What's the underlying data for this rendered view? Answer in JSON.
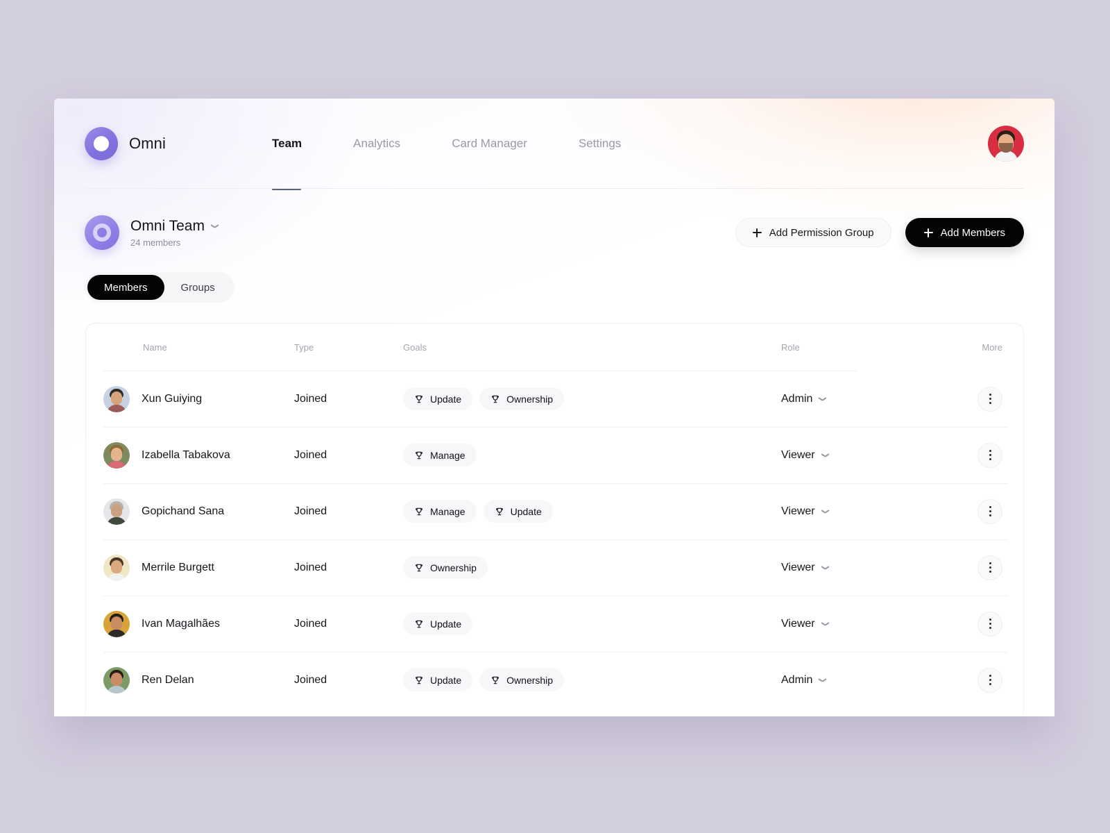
{
  "brand": {
    "name": "Omni",
    "logo_icon": "omni-ring-logo",
    "accent": "#8375de"
  },
  "nav": {
    "items": [
      {
        "label": "Team",
        "active": true
      },
      {
        "label": "Analytics",
        "active": false
      },
      {
        "label": "Card Manager",
        "active": false
      },
      {
        "label": "Settings",
        "active": false
      }
    ],
    "active_underline_color": "#5b6275"
  },
  "account": {
    "avatar_icon": "user-avatar",
    "avatar_bg": "#d92d42"
  },
  "team_header": {
    "avatar_icon": "team-avatar",
    "name": "Omni Team",
    "dropdown_icon": "chevron-down-icon",
    "members_count": "24 members",
    "actions": [
      {
        "label": "Add Permission Group",
        "icon": "plus-icon",
        "style": "ghost"
      },
      {
        "label": "Add Members",
        "icon": "plus-icon",
        "style": "primary"
      }
    ]
  },
  "segmented": {
    "options": [
      {
        "label": "Members",
        "active": true
      },
      {
        "label": "Groups",
        "active": false
      }
    ]
  },
  "table": {
    "columns": [
      "Name",
      "Type",
      "Goals",
      "Role",
      "More"
    ],
    "rows": [
      {
        "name": "Xun Guiying",
        "type": "Joined",
        "goals": [
          "Update",
          "Ownership"
        ],
        "role": "Admin",
        "avatar": {
          "bg": "#c4d2e4",
          "hair": "#2f2a24",
          "face": "#d8a47e",
          "body": "#9c5a58"
        }
      },
      {
        "name": "Izabella Tabakova",
        "type": "Joined",
        "goals": [
          "Manage"
        ],
        "role": "Viewer",
        "avatar": {
          "bg": "#7d8a5e",
          "hair": "#8c6a3a",
          "face": "#e3b48d",
          "body": "#d86a78"
        }
      },
      {
        "name": "Gopichand Sana",
        "type": "Joined",
        "goals": [
          "Manage",
          "Update"
        ],
        "role": "Viewer",
        "avatar": {
          "bg": "#e6e6ea",
          "hair": "#b9b2ab",
          "face": "#caa183",
          "body": "#3f4a3d"
        }
      },
      {
        "name": "Merrile Burgett",
        "type": "Joined",
        "goals": [
          "Ownership"
        ],
        "role": "Viewer",
        "avatar": {
          "bg": "#efe6c4",
          "hair": "#4a3527",
          "face": "#dba97f",
          "body": "#f2f2f2"
        }
      },
      {
        "name": "Ivan Magalhães",
        "type": "Joined",
        "goals": [
          "Update"
        ],
        "role": "Viewer",
        "avatar": {
          "bg": "#d8a43a",
          "hair": "#241c16",
          "face": "#c98d62",
          "body": "#2e2a28"
        }
      },
      {
        "name": "Ren Delan",
        "type": "Joined",
        "goals": [
          "Update",
          "Ownership"
        ],
        "role": "Admin",
        "avatar": {
          "bg": "#7e9a66",
          "hair": "#2a1c14",
          "face": "#c98c66",
          "body": "#b9c6cd"
        }
      }
    ],
    "goal_icon": "trophy-icon",
    "role_dropdown_icon": "chevron-down-icon",
    "more_icon": "more-vertical-icon"
  }
}
